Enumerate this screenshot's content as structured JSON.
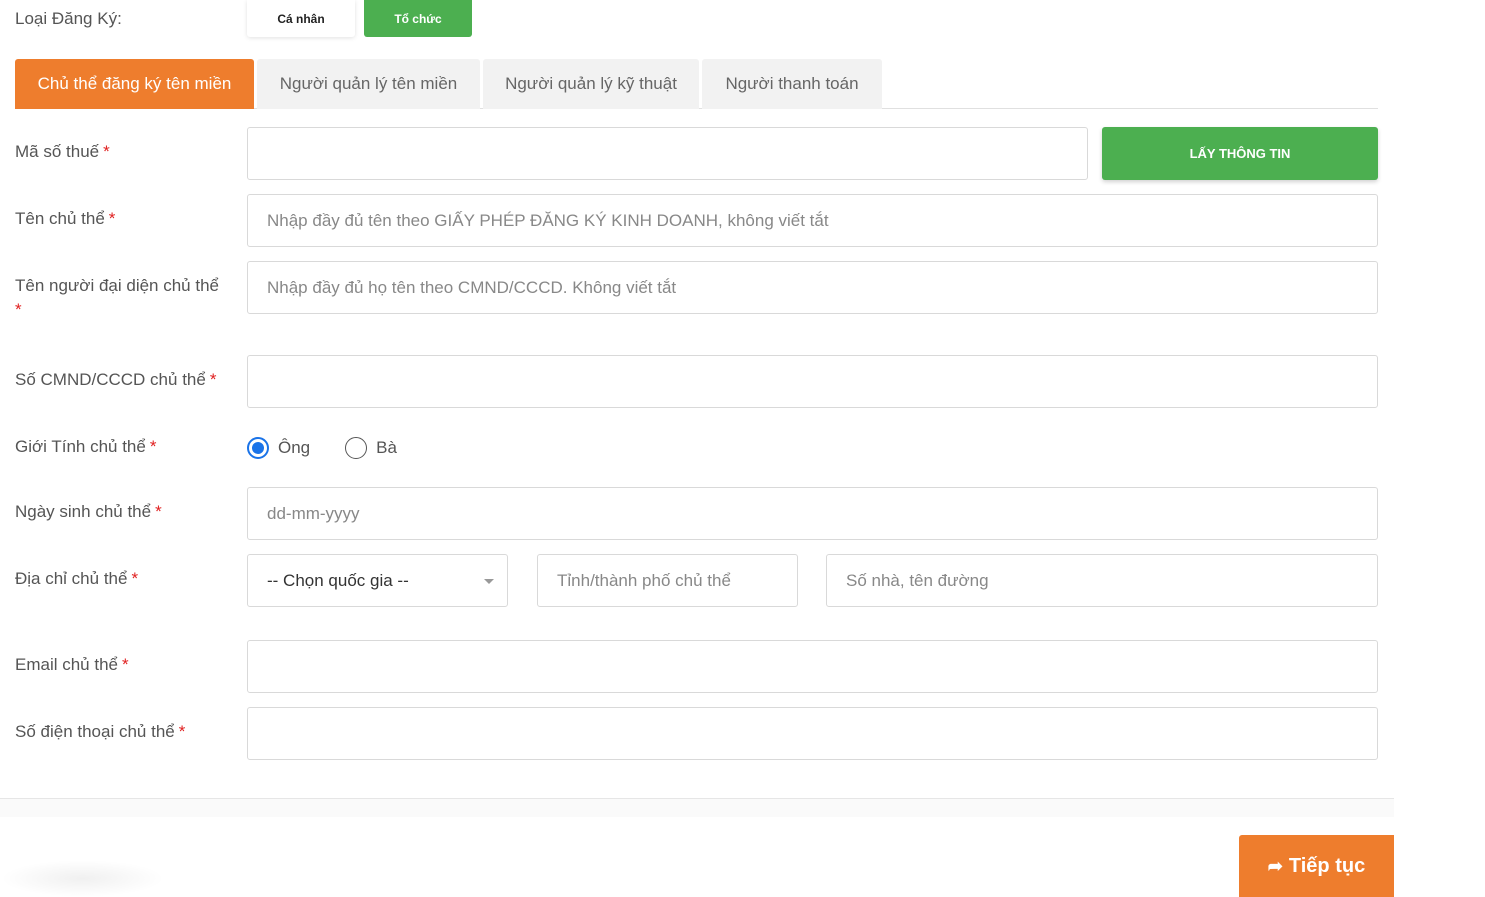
{
  "registration_type": {
    "label": "Loại Đăng Ký:",
    "individual": "Cá nhân",
    "organization": "Tổ chức"
  },
  "tabs": [
    {
      "label": "Chủ thể đăng ký tên miền",
      "active": true
    },
    {
      "label": "Người quản lý tên miền",
      "active": false
    },
    {
      "label": "Người quản lý kỹ thuật",
      "active": false
    },
    {
      "label": "Người thanh toán",
      "active": false
    }
  ],
  "required_mark": "*",
  "form": {
    "tax_code": {
      "label": "Mã số thuế",
      "value": "",
      "placeholder": ""
    },
    "get_info_button": "LẤY THÔNG TIN",
    "owner_name": {
      "label": "Tên chủ thể",
      "placeholder": "Nhập đầy đủ tên theo GIẤY PHÉP ĐĂNG KÝ KINH DOANH, không viết tắt"
    },
    "representative_name": {
      "label": "Tên người đại diện chủ thể",
      "placeholder": "Nhập đầy đủ họ tên theo CMND/CCCD. Không viết tắt"
    },
    "id_number": {
      "label": "Số CMND/CCCD chủ thể",
      "placeholder": ""
    },
    "gender": {
      "label": "Giới Tính chủ thể",
      "options": [
        "Ông",
        "Bà"
      ],
      "selected": "Ông"
    },
    "birthdate": {
      "label": "Ngày sinh chủ thể",
      "placeholder": "dd-mm-yyyy"
    },
    "address": {
      "label": "Địa chỉ chủ thể",
      "country_select": "-- Chọn quốc gia --",
      "city_placeholder": "Tỉnh/thành phố chủ thể",
      "street_placeholder": "Số nhà, tên đường"
    },
    "email": {
      "label": "Email chủ thể",
      "placeholder": ""
    },
    "phone": {
      "label": "Số điện thoại chủ thể",
      "placeholder": ""
    }
  },
  "footer": {
    "continue_label": "Tiếp tục"
  },
  "colors": {
    "accent_orange": "#ee7d2d",
    "green": "#4caf50",
    "radio_blue": "#1a73e8",
    "required_red": "#e02020"
  }
}
